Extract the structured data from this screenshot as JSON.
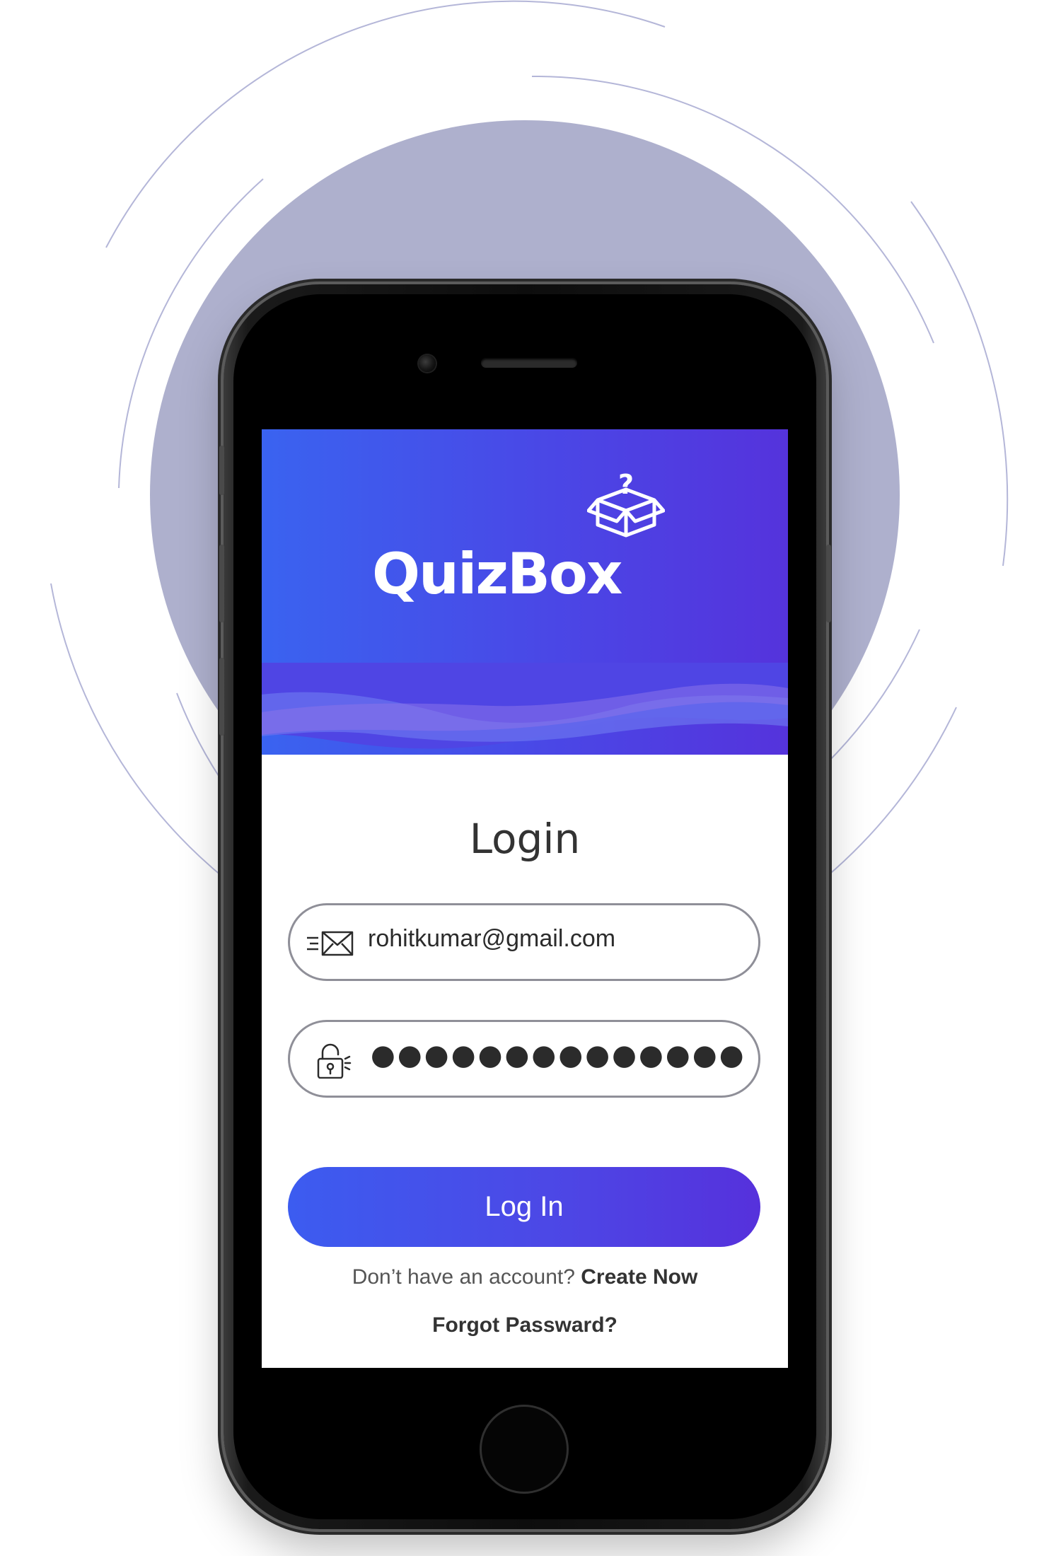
{
  "app": {
    "brand": "QuizBox",
    "brand_box_mark": "?"
  },
  "login": {
    "title": "Login",
    "email_value": "rohitkumar@gmail.com",
    "password_masked": "●●●●●●●●●●●●●●",
    "login_button_label": "Log In",
    "signup_prompt": "Don’t have an account?",
    "signup_link": "Create Now",
    "forgot_password": "Forgot Passward?"
  },
  "icons": {
    "email": "email-icon",
    "lock": "unlock-icon"
  },
  "colors": {
    "header_start": "#3a63f0",
    "header_end": "#5533dc",
    "backdrop_circle": "#aeb0cd",
    "field_border": "#8f8f98"
  }
}
